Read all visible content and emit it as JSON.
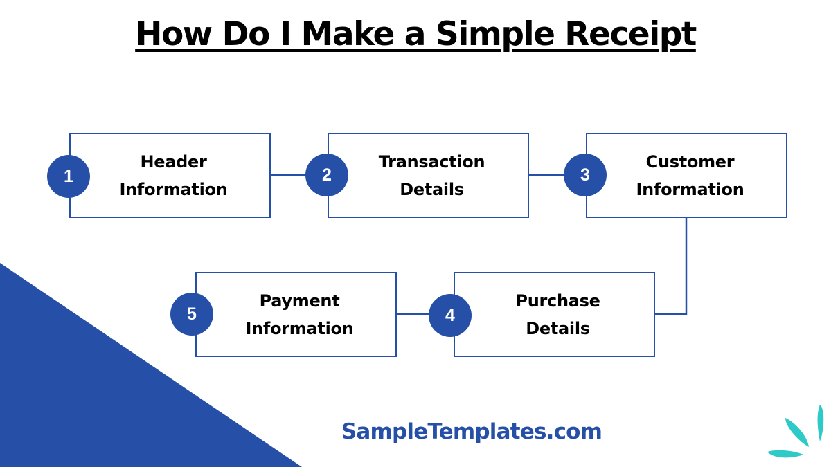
{
  "title": "How Do I Make a Simple Receipt",
  "steps": [
    {
      "number": "1",
      "label": "Header\nInformation"
    },
    {
      "number": "2",
      "label": "Transaction\nDetails"
    },
    {
      "number": "3",
      "label": "Customer\nInformation"
    },
    {
      "number": "4",
      "label": "Purchase\nDetails"
    },
    {
      "number": "5",
      "label": "Payment\nInformation"
    }
  ],
  "brand": "SampleTemplates.com",
  "colors": {
    "primary": "#264fa8",
    "accent": "#2ecac8",
    "text": "#000000"
  }
}
